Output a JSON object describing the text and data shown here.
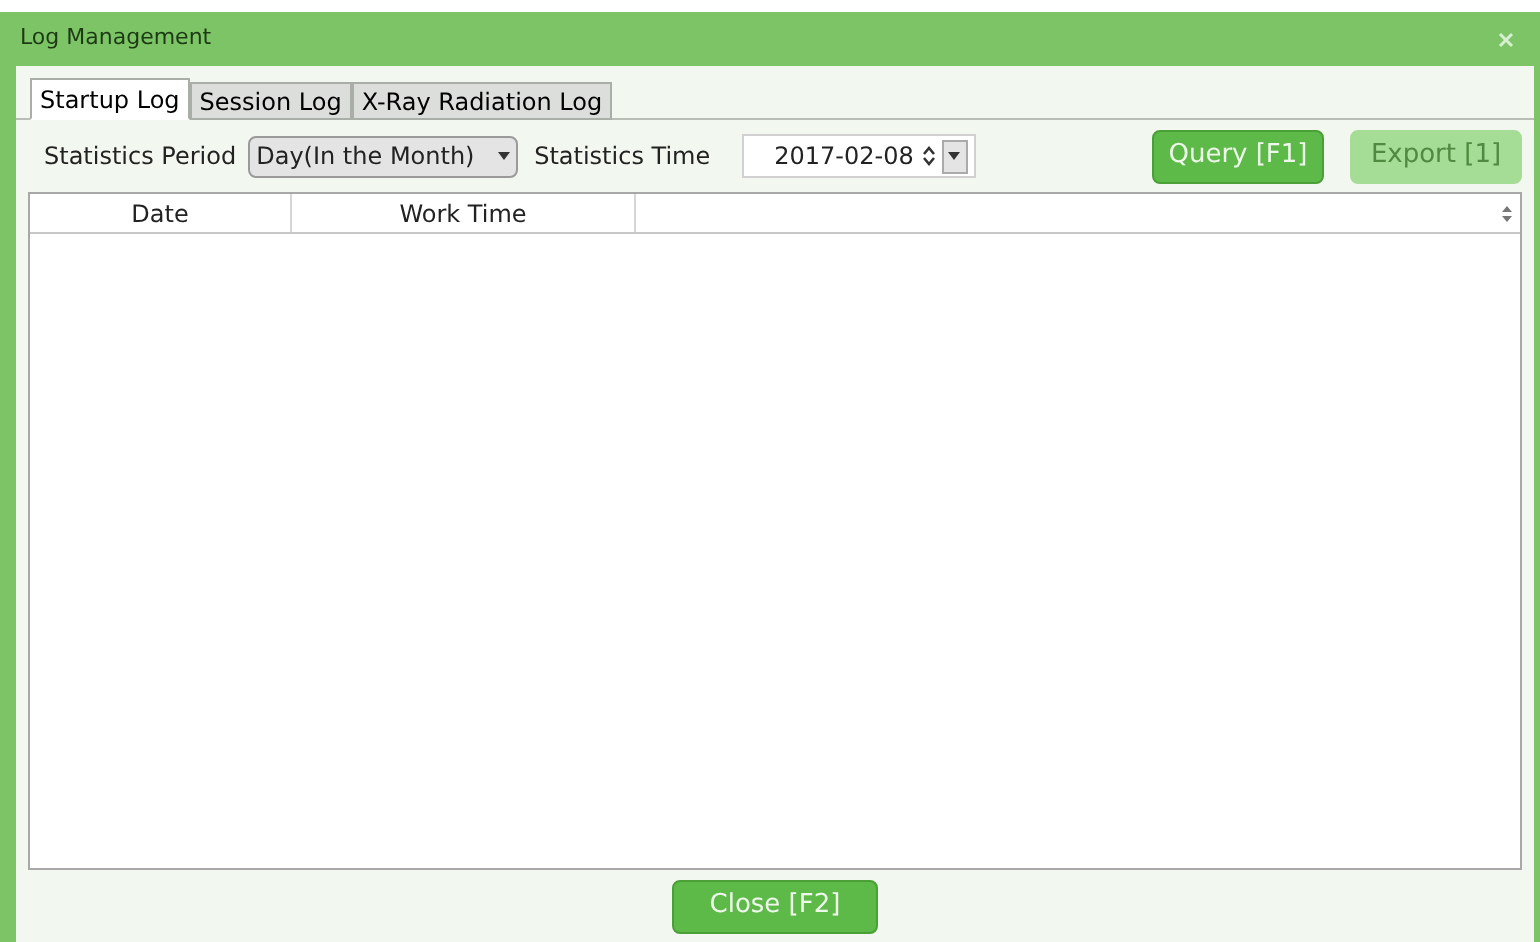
{
  "window": {
    "title": "Log Management"
  },
  "tabs": [
    {
      "label": "Startup Log",
      "selected": true
    },
    {
      "label": "Session Log",
      "selected": false
    },
    {
      "label": "X-Ray Radiation Log",
      "selected": false
    }
  ],
  "filters": {
    "period_label": "Statistics Period",
    "period_value": "Day(In the Month)",
    "time_label": "Statistics Time",
    "time_value": "2017-02-08"
  },
  "actions": [
    {
      "label": "Query [F1]",
      "disabled": false
    },
    {
      "label": "Export [1]",
      "disabled": true
    }
  ],
  "table": {
    "columns": [
      "Date",
      "Work Time"
    ]
  },
  "footer": {
    "close": {
      "label": "Close [F2]",
      "disabled": false
    }
  }
}
